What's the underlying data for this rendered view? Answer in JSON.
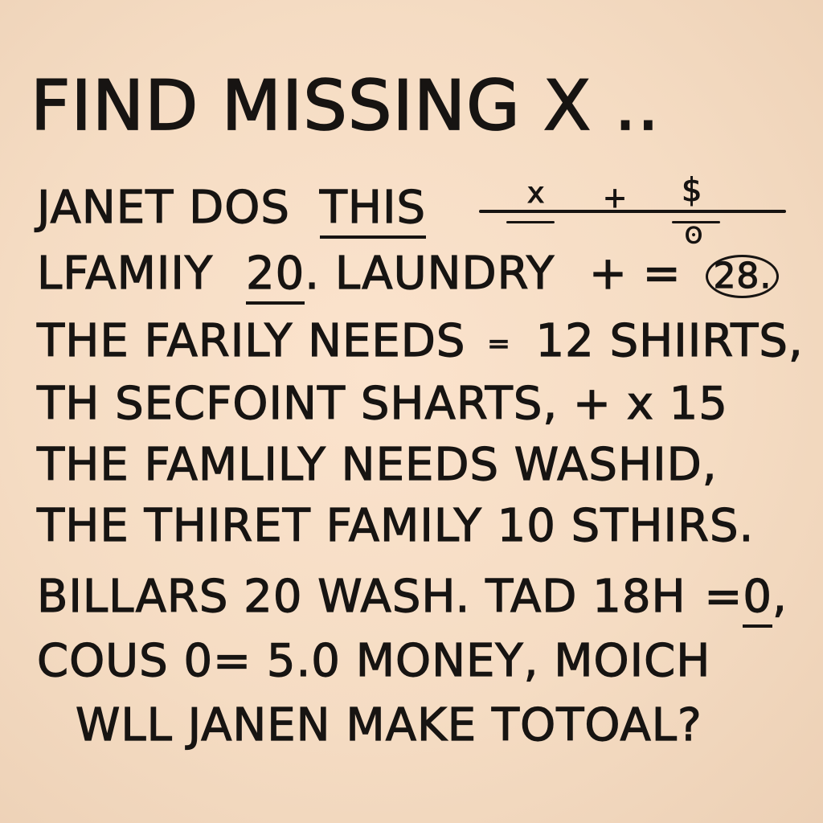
{
  "title": "FIND MISSING X ..",
  "lines": {
    "l1": {
      "text": "JANET DOS",
      "underlined": "THIS"
    },
    "l1_formula": {
      "x": "x",
      "plus": "+",
      "dollar": "$",
      "dot": "•",
      "bottom_dot": "ʘ"
    },
    "l2": {
      "a": "LFAMIIY",
      "num": "20",
      "b": ". LAUNDRY",
      "ops": "+ =",
      "circled": "28."
    },
    "l3": {
      "a": "THE FARILY NEEDS",
      "sym": "=",
      "b": "12 SHIIRTS,",
      "mark": "≈"
    },
    "l4": {
      "text": "TH SECFOINT SHARTS, + x 15"
    },
    "l5": {
      "text": "THE  FAMLILY NEEDS  WASHID,"
    },
    "l6": {
      "text": "THE THIRET FAMILY 10 STHIRS."
    },
    "l7": {
      "a": "BILLARS 20  WASH.  TAD 18H",
      "eq": "=",
      "zero": "0",
      "tail": ","
    },
    "l8": {
      "text": "COUS 0= 5.0 MONEY, MOICH"
    },
    "l9": {
      "text": "WLL JANEN  MAKE  TOTOAL?"
    }
  }
}
